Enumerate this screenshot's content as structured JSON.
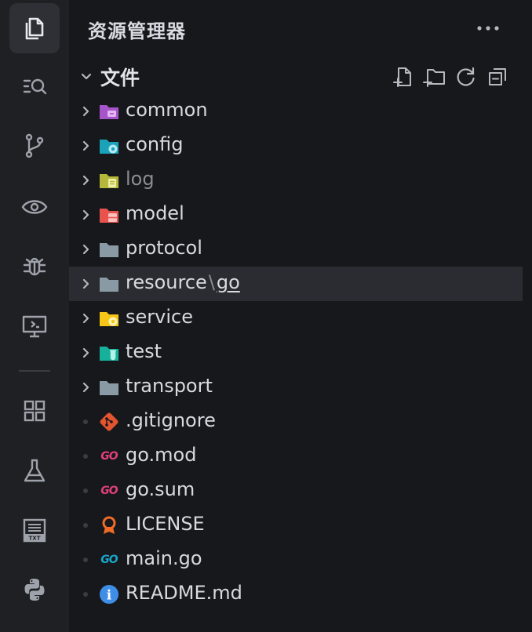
{
  "activity_bar": {
    "items": [
      {
        "name": "explorer",
        "icon": "files-icon",
        "active": true
      },
      {
        "name": "search",
        "icon": "search-list-icon"
      },
      {
        "name": "source-control",
        "icon": "git-branch-icon"
      },
      {
        "name": "watch",
        "icon": "eye-icon"
      },
      {
        "name": "debug",
        "icon": "bug-icon"
      },
      {
        "name": "remote",
        "icon": "remote-monitor-icon"
      },
      {
        "name": "extensions",
        "icon": "extensions-grid-icon"
      },
      {
        "name": "testing",
        "icon": "flask-icon"
      },
      {
        "name": "txt",
        "icon": "txt-file-icon",
        "text": "TXT"
      },
      {
        "name": "python",
        "icon": "python-icon"
      }
    ]
  },
  "sidebar": {
    "title": "资源管理器",
    "more_label": "···",
    "section": {
      "title": "文件",
      "actions": [
        "new-file",
        "new-folder",
        "refresh",
        "collapse-all"
      ]
    }
  },
  "tree": {
    "items": [
      {
        "label": "common",
        "type": "folder",
        "icon": "folder-common-icon",
        "color": "#a455c7"
      },
      {
        "label": "config",
        "type": "folder",
        "icon": "folder-config-icon",
        "color": "#1ba2b8"
      },
      {
        "label": "log",
        "type": "folder",
        "icon": "folder-log-icon",
        "color": "#b5b83a",
        "dim": true
      },
      {
        "label": "model",
        "type": "folder",
        "icon": "folder-model-icon",
        "color": "#e8534e"
      },
      {
        "label": "protocol",
        "type": "folder",
        "icon": "folder-icon",
        "color": "#8a9aa5"
      },
      {
        "label": "resource",
        "type": "folder",
        "icon": "folder-icon",
        "color": "#8a9aa5",
        "selected": true,
        "compact_sep": "\\",
        "compact_sub": "go"
      },
      {
        "label": "service",
        "type": "folder",
        "icon": "folder-service-icon",
        "color": "#f5c518"
      },
      {
        "label": "test",
        "type": "folder",
        "icon": "folder-test-icon",
        "color": "#17b09a"
      },
      {
        "label": "transport",
        "type": "folder",
        "icon": "folder-icon",
        "color": "#8a9aa5"
      },
      {
        "label": ".gitignore",
        "type": "file",
        "icon": "git-icon",
        "color": "#e2552f"
      },
      {
        "label": "go.mod",
        "type": "file",
        "icon": "go-mod-icon",
        "color": "#e0407a",
        "icon_text": "GO"
      },
      {
        "label": "go.sum",
        "type": "file",
        "icon": "go-sum-icon",
        "color": "#e0407a",
        "icon_text": "GO"
      },
      {
        "label": "LICENSE",
        "type": "file",
        "icon": "license-icon",
        "color": "#f06b28"
      },
      {
        "label": "main.go",
        "type": "file",
        "icon": "go-icon",
        "color": "#1aa6c9",
        "icon_text": "GO"
      },
      {
        "label": "README.md",
        "type": "file",
        "icon": "info-icon",
        "color": "#3e8ee8",
        "icon_text": "i"
      }
    ]
  }
}
